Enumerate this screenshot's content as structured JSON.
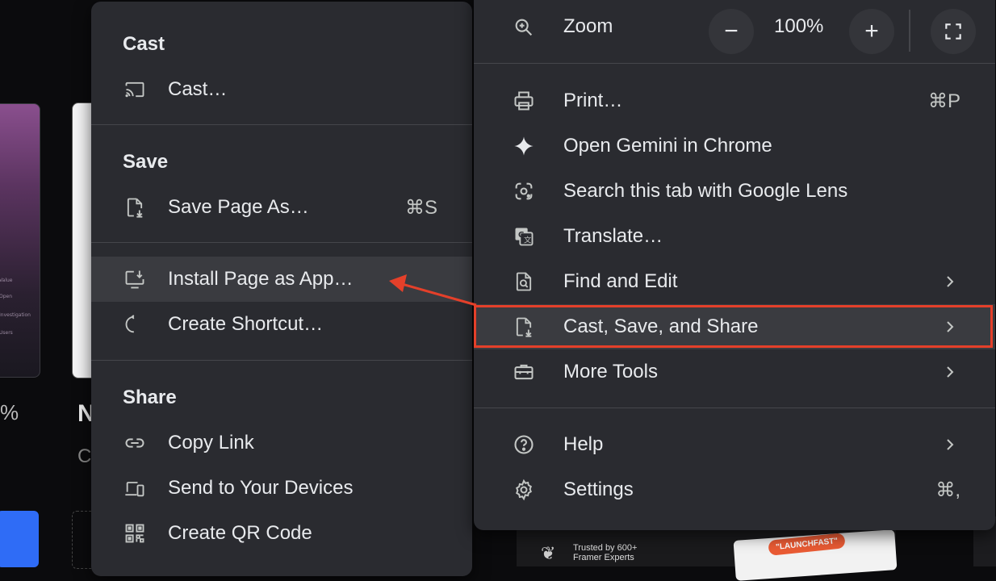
{
  "submenu": {
    "sections": [
      {
        "title": "Cast",
        "items": [
          {
            "label": "Cast…",
            "icon": "cast-icon",
            "shortcut": ""
          }
        ]
      },
      {
        "title": "Save",
        "items": [
          {
            "label": "Save Page As…",
            "icon": "save-page-icon",
            "shortcut": "⌘S"
          }
        ]
      },
      {
        "title": "",
        "items": [
          {
            "label": "Install Page as App…",
            "icon": "install-app-icon",
            "shortcut": "",
            "highlighted": true
          },
          {
            "label": "Create Shortcut…",
            "icon": "shortcut-icon",
            "shortcut": ""
          }
        ]
      },
      {
        "title": "Share",
        "items": [
          {
            "label": "Copy Link",
            "icon": "link-icon"
          },
          {
            "label": "Send to Your Devices",
            "icon": "devices-icon"
          },
          {
            "label": "Create QR Code",
            "icon": "qr-code-icon"
          }
        ]
      }
    ]
  },
  "mainmenu": {
    "zoom": {
      "label": "Zoom",
      "value": "100%",
      "minus": "−",
      "plus": "+"
    },
    "items": [
      {
        "label": "Print…",
        "icon": "print-icon",
        "shortcut": "⌘P"
      },
      {
        "label": "Open Gemini in Chrome",
        "icon": "gemini-sparkle-icon"
      },
      {
        "label": "Search this tab with Google Lens",
        "icon": "google-lens-icon"
      },
      {
        "label": "Translate…",
        "icon": "translate-icon"
      },
      {
        "label": "Find and Edit",
        "icon": "find-icon",
        "submenu": true
      },
      {
        "label": "Cast, Save, and Share",
        "icon": "cast-save-share-icon",
        "submenu": true,
        "highlighted": true
      },
      {
        "label": "More Tools",
        "icon": "toolbox-icon",
        "submenu": true
      },
      {
        "label": "Help",
        "icon": "help-icon",
        "submenu": true
      },
      {
        "label": "Settings",
        "icon": "settings-gear-icon",
        "shortcut": "⌘,"
      }
    ]
  },
  "background": {
    "percent_fragment": "%",
    "heading_fragment": "N",
    "subtext_fragment": "C",
    "promo_trusted": "Trusted by 600+ Framer Experts",
    "promo_badge": "\"LAUNCHFAST\""
  },
  "colors": {
    "menu_bg": "#2a2b30",
    "highlight_bg": "#3a3b40",
    "annotation_red": "#e4402a"
  }
}
